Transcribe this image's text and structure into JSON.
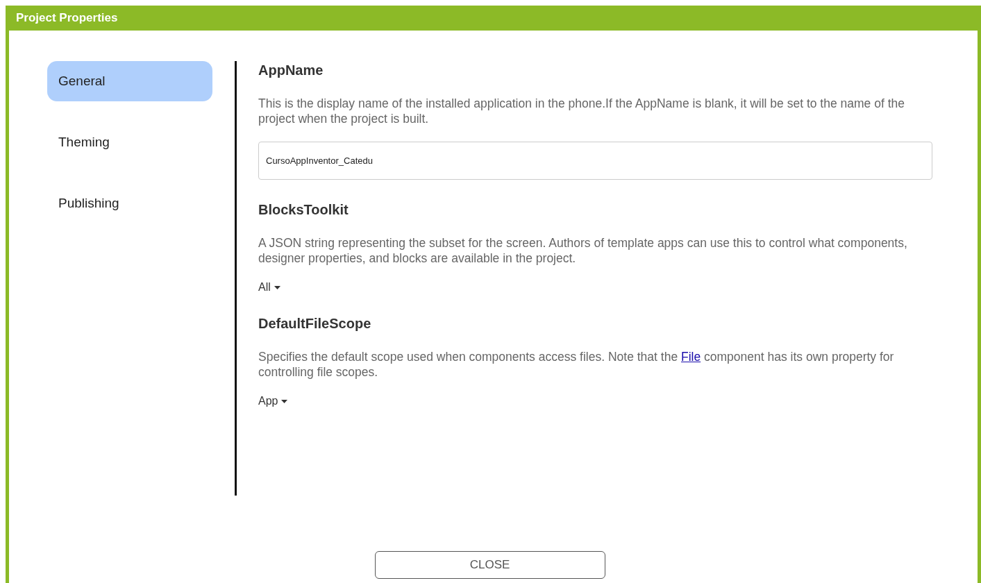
{
  "window": {
    "title": "Project Properties"
  },
  "sidebar": {
    "items": [
      {
        "label": "General",
        "selected": true
      },
      {
        "label": "Theming",
        "selected": false
      },
      {
        "label": "Publishing",
        "selected": false
      }
    ]
  },
  "properties": [
    {
      "name": "AppName",
      "kind": "text",
      "description": [
        {
          "kind": "text",
          "text": "This is the display name of the installed application in the phone.If the AppName is blank, it will be set to the name of the project when the project is built."
        }
      ],
      "value": "CursoAppInventor_Catedu"
    },
    {
      "name": "BlocksToolkit",
      "kind": "dropdown",
      "description": [
        {
          "kind": "text",
          "text": "A JSON string representing the subset for the screen. Authors of template apps can use this to control what components, designer properties, and blocks are available in the project."
        }
      ],
      "value": "All"
    },
    {
      "name": "DefaultFileScope",
      "kind": "dropdown",
      "description": [
        {
          "kind": "text",
          "text": "Specifies the default scope used when components access files. Note that the "
        },
        {
          "kind": "link",
          "text": "File"
        },
        {
          "kind": "text",
          "text": " component has its own property for controlling file scopes."
        }
      ],
      "value": "App"
    }
  ],
  "close_button": "CLOSE"
}
